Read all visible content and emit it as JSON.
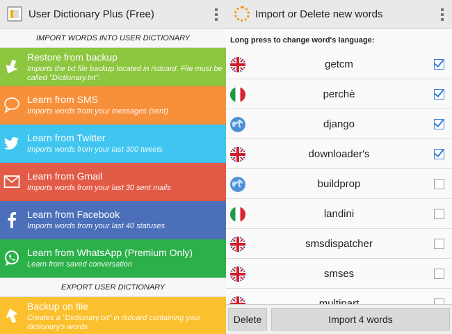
{
  "left": {
    "title": "User Dictionary Plus (Free)",
    "import_header": "IMPORT WORDS INTO USER DICTIONARY",
    "import_items": [
      {
        "name": "restore",
        "icon": "arrow-down-icon",
        "color": "#8dc63f",
        "title": "Restore from backup",
        "subtitle": "Imports the txt file backup located in /sdcard. File must be called \"Dictionary.txt\"."
      },
      {
        "name": "sms",
        "icon": "sms-bubble-icon",
        "color": "#f7903a",
        "title": "Learn from SMS",
        "subtitle": "Imports words from your messages (sent)"
      },
      {
        "name": "twitter",
        "icon": "twitter-bird-icon",
        "color": "#3fc5f0",
        "title": "Learn from Twitter",
        "subtitle": "Imports words from your last 300 tweets"
      },
      {
        "name": "gmail",
        "icon": "envelope-icon",
        "color": "#e25b47",
        "title": "Learn from Gmail",
        "subtitle": "Imports words from your last 30 sent mails"
      },
      {
        "name": "facebook",
        "icon": "facebook-f-icon",
        "color": "#4c6fba",
        "title": "Learn from Facebook",
        "subtitle": "Imports words from your last 40 statuses"
      },
      {
        "name": "whatsapp",
        "icon": "whatsapp-phone-icon",
        "color": "#2bb04a",
        "title": "Learn from WhatsApp (Premium Only)",
        "subtitle": "Learn from saved conversation"
      }
    ],
    "export_header": "EXPORT USER DICTIONARY",
    "export_items": [
      {
        "name": "backup",
        "icon": "arrow-up-icon",
        "color": "#fbc02d",
        "title": "Backup on file",
        "subtitle": "Creates a \"Dictionary.txt\" in /sdcard containing your dictionary's words"
      }
    ]
  },
  "right": {
    "title": "Import or Delete new words",
    "list_header": "Long press to change word's language:",
    "words": [
      {
        "word": "getcm",
        "lang": "uk",
        "checked": true
      },
      {
        "word": "perchè",
        "lang": "it",
        "checked": true
      },
      {
        "word": "django",
        "lang": "globe",
        "checked": true
      },
      {
        "word": "downloader's",
        "lang": "uk",
        "checked": true
      },
      {
        "word": "buildprop",
        "lang": "globe",
        "checked": false
      },
      {
        "word": "landini",
        "lang": "it",
        "checked": false
      },
      {
        "word": "smsdispatcher",
        "lang": "uk",
        "checked": false
      },
      {
        "word": "smses",
        "lang": "uk",
        "checked": false
      },
      {
        "word": "multipart",
        "lang": "uk",
        "checked": false
      }
    ],
    "delete_label": "Delete",
    "import_label": "Import 4 words"
  }
}
